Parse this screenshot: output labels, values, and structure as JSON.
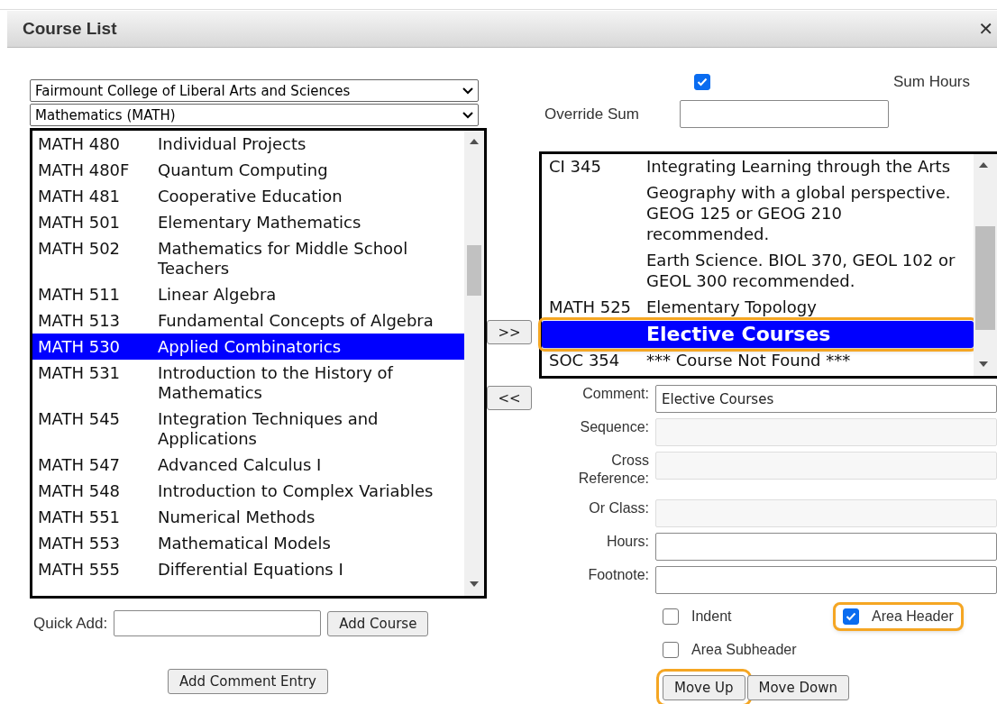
{
  "window": {
    "title": "Course List",
    "close": "✕"
  },
  "college_select": {
    "value": "Fairmount College of Liberal Arts and Sciences"
  },
  "department_select": {
    "value": "Mathematics (MATH)"
  },
  "available_courses": [
    {
      "code": "MATH 480",
      "title": "Individual Projects",
      "selected": false
    },
    {
      "code": "MATH 480F",
      "title": "Quantum Computing",
      "selected": false
    },
    {
      "code": "MATH 481",
      "title": "Cooperative Education",
      "selected": false
    },
    {
      "code": "MATH 501",
      "title": "Elementary Mathematics",
      "selected": false
    },
    {
      "code": "MATH 502",
      "title": "Mathematics for Middle School Teachers",
      "selected": false
    },
    {
      "code": "MATH 511",
      "title": "Linear Algebra",
      "selected": false
    },
    {
      "code": "MATH 513",
      "title": "Fundamental Concepts of Algebra",
      "selected": false
    },
    {
      "code": "MATH 530",
      "title": "Applied Combinatorics",
      "selected": true
    },
    {
      "code": "MATH 531",
      "title": "Introduction to the History of Mathematics",
      "selected": false
    },
    {
      "code": "MATH 545",
      "title": "Integration Techniques and Applications",
      "selected": false
    },
    {
      "code": "MATH 547",
      "title": "Advanced Calculus I",
      "selected": false
    },
    {
      "code": "MATH 548",
      "title": "Introduction to Complex Variables",
      "selected": false
    },
    {
      "code": "MATH 551",
      "title": "Numerical Methods",
      "selected": false
    },
    {
      "code": "MATH 553",
      "title": "Mathematical Models",
      "selected": false
    },
    {
      "code": "MATH 555",
      "title": "Differential Equations I",
      "selected": false
    }
  ],
  "add_button": ">>",
  "remove_button": "<<",
  "sum_hours": {
    "label": "Sum Hours",
    "checked": true
  },
  "override_sum": {
    "label": "Override Sum"
  },
  "chosen_courses": [
    {
      "kind": "course",
      "code": "CI 345",
      "title": "Integrating Learning through the Arts",
      "selected": false,
      "callout": false
    },
    {
      "kind": "comment",
      "title": "Geography with a global perspective. GEOG 125 or GEOG 210 recommended.",
      "selected": false,
      "callout": false
    },
    {
      "kind": "comment",
      "title": "Earth Science. BIOL 370, GEOL 102 or GEOL 300 recommended.",
      "selected": false,
      "callout": false
    },
    {
      "kind": "course",
      "code": "MATH 525",
      "title": "Elementary Topology",
      "selected": false,
      "callout": false
    },
    {
      "kind": "header",
      "title": "Elective Courses",
      "selected": true,
      "callout": true
    },
    {
      "kind": "course",
      "code": "SOC 354",
      "title": "*** Course Not Found ***",
      "selected": false,
      "callout": false
    }
  ],
  "fields": [
    {
      "label": "Comment:",
      "value": "Elective Courses",
      "disabled": false
    },
    {
      "label": "Sequence:",
      "disabled": true
    },
    {
      "label": "Cross Reference:",
      "disabled": true
    },
    {
      "label": "Or Class:",
      "disabled": true
    },
    {
      "label": "Hours:",
      "disabled": false
    },
    {
      "label": "Footnote:",
      "disabled": false
    }
  ],
  "options": [
    {
      "label": "Indent",
      "checked": false,
      "callout": false
    },
    {
      "label": "Area Header",
      "checked": true,
      "callout": true
    },
    {
      "label": "Area Subheader",
      "checked": false,
      "callout": false
    }
  ],
  "quick_add": {
    "label": "Quick Add:",
    "button": "Add Course"
  },
  "add_comment_button": "Add Comment Entry",
  "move_buttons": [
    {
      "label": "Move Up",
      "callout": true
    },
    {
      "label": "Move Down",
      "callout": false
    }
  ]
}
